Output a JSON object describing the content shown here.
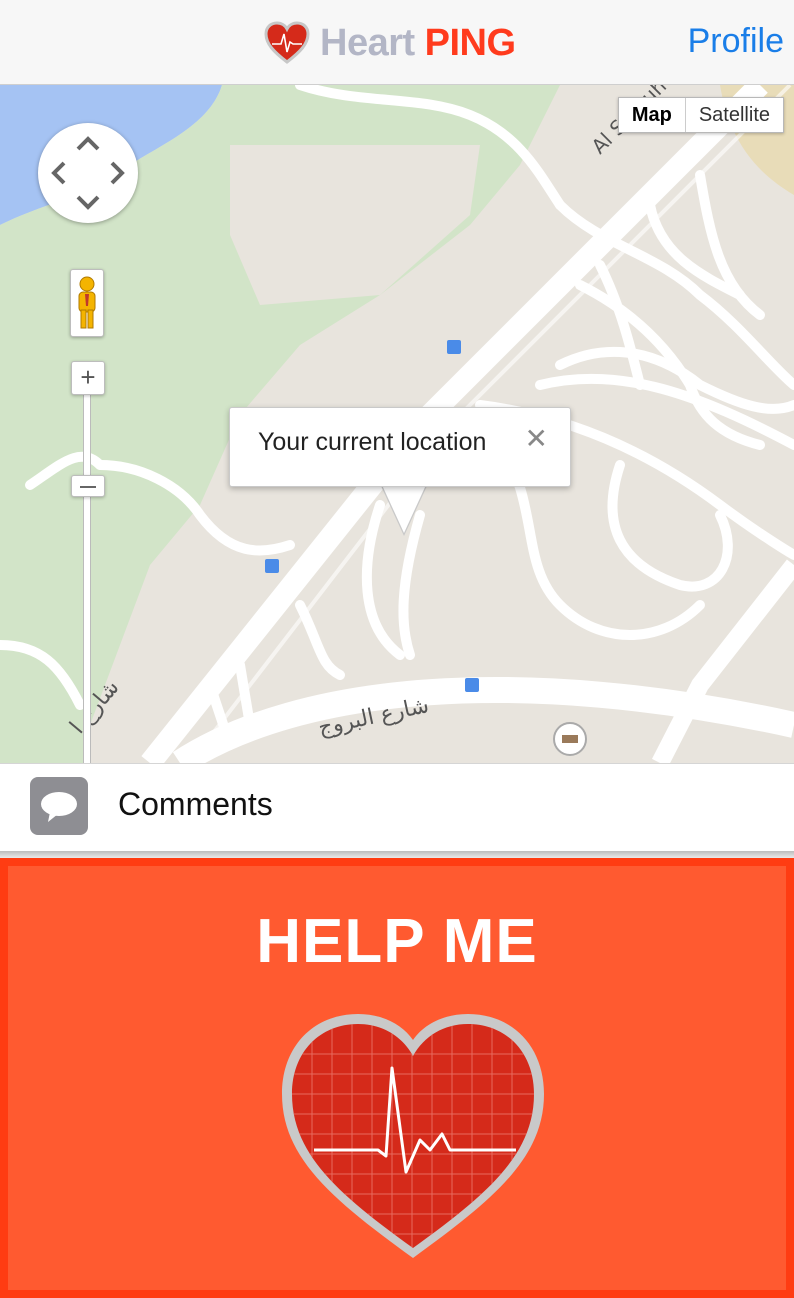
{
  "header": {
    "logo_word_1": "Heart",
    "logo_word_2": "PING",
    "logo_icon": "heart-ecg-icon",
    "profile_label": "Profile"
  },
  "map": {
    "type_buttons": [
      "Map",
      "Satellite"
    ],
    "selected_type": "Map",
    "info_window_text": "Your current location",
    "street_labels": [
      "Al Sufouh",
      "شارع البروج",
      "شارع ا"
    ],
    "controls": {
      "pan": "pan-control-icon",
      "street_view": "pegman-icon",
      "zoom_in": "+",
      "zoom_out": "−"
    }
  },
  "comments": {
    "label": "Comments",
    "icon": "chat-bubble-icon"
  },
  "help": {
    "title": "HELP ME",
    "icon": "heart-ecg-icon"
  },
  "colors": {
    "brand_red": "#ff3b1d",
    "help_background": "#ff5a30",
    "link_blue": "#1a7ee8",
    "logo_grey": "#b3b6c6"
  }
}
